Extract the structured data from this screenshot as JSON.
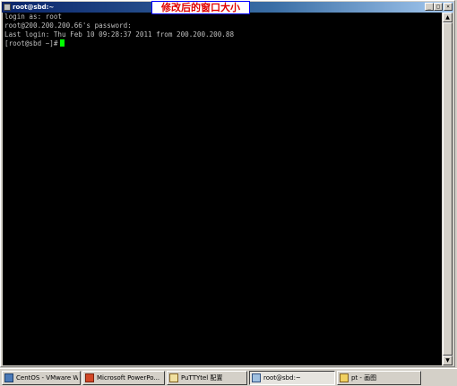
{
  "window": {
    "title": "root@sbd:~",
    "annotation": "修改后的窗口大小",
    "minimize_glyph": "_",
    "maximize_glyph": "□",
    "close_glyph": "×"
  },
  "terminal": {
    "lines": [
      "login as: root",
      "root@200.200.200.66's password:",
      "Last login: Thu Feb 10 09:28:37 2011 from 200.200.200.88",
      "[root@sbd ~]#"
    ],
    "cursor_color": "#00ff00",
    "foreground_color": "#c0c0c0",
    "background_color": "#000000"
  },
  "scrollbar": {
    "up_glyph": "▲",
    "down_glyph": "▼"
  },
  "taskbar": {
    "items": [
      {
        "label": "CentOS - VMware W...",
        "icon": "vmware-icon",
        "active": false
      },
      {
        "label": "Microsoft PowerPo...",
        "icon": "powerpoint-icon",
        "active": false
      },
      {
        "label": "PuTTYtel 配置",
        "icon": "putty-config-icon",
        "active": false
      },
      {
        "label": "root@sbd:~",
        "icon": "putty-icon",
        "active": true
      },
      {
        "label": "pt - 画图",
        "icon": "paint-icon",
        "active": false
      }
    ]
  }
}
